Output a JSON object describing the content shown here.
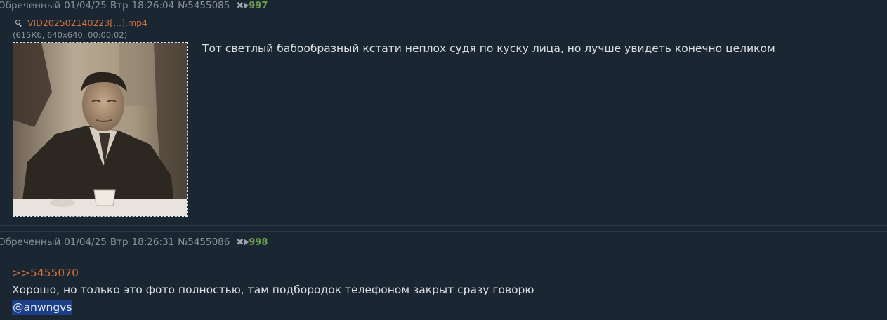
{
  "posts": [
    {
      "name": "Обреченный",
      "date": "01/04/25",
      "day": "Втр",
      "time": "18:26:04",
      "id": "№5455085",
      "number": "997",
      "file": {
        "name": "VID202502140223[...].mp4",
        "meta": "(615Кб, 640x640, 00:00:02)"
      },
      "text": "Тот светлый бабообразный кстати неплох судя по куску лица, но лучше увидеть конечно целиком"
    },
    {
      "name": "Обреченный",
      "date": "01/04/25",
      "day": "Втр",
      "time": "18:26:31",
      "id": "№5455086",
      "number": "998",
      "reply_to": ">>5455070",
      "text": "Хорошо, но только это фото полностью, там подбородок телефоном закрыт сразу говорю",
      "mention": "@anwngvs"
    }
  ],
  "icons": {
    "close": "close-icon",
    "play": "play-icon",
    "search": "search-icon"
  },
  "colors": {
    "background": "#1b2633",
    "link": "#d4713a",
    "post_number": "#6a9a4a",
    "mention_highlight": "#1d3f8a"
  }
}
